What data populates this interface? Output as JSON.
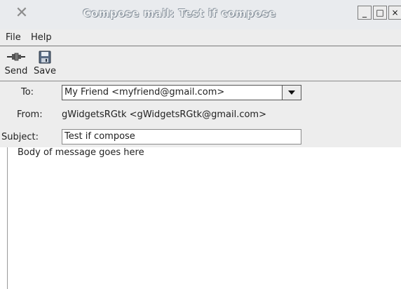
{
  "window": {
    "title": "Compose mail: Test if compose",
    "buttons": {
      "minimize": "_",
      "maximize": "□",
      "close": "×"
    },
    "app_icon": "x-logo-icon"
  },
  "menubar": {
    "items": [
      "File",
      "Help"
    ]
  },
  "toolbar": {
    "send_label": "Send",
    "save_label": "Save",
    "send_icon": "plug-icon",
    "save_icon": "floppy-disk-icon"
  },
  "form": {
    "to_label": "To:",
    "to_value": "My Friend <myfriend@gmail.com>",
    "from_label": "From:",
    "from_value": "gWidgetsRGtk <gWidgetsRGtk@gmail.com>",
    "subject_label": "Subject:",
    "subject_value": "Test if compose"
  },
  "body": {
    "text": "Body of message goes here"
  }
}
